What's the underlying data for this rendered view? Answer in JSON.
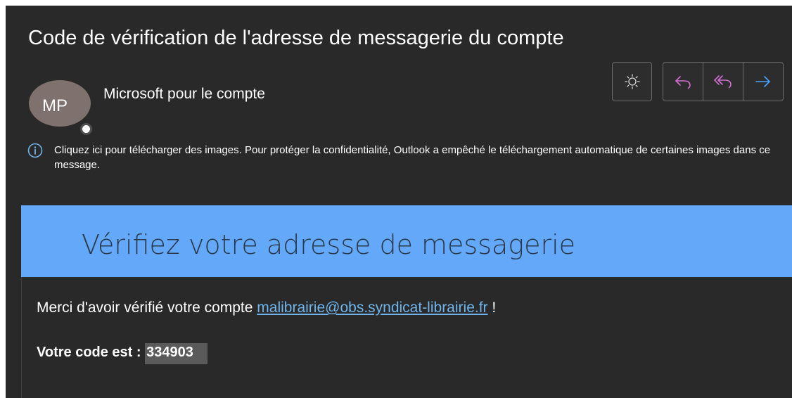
{
  "message": {
    "subject": "Code de vérification de l'adresse de messagerie du compte",
    "sender": {
      "initials": "MP",
      "name": "Microsoft pour le compte"
    },
    "info_bar": "Cliquez ici pour télécharger des images. Pour protéger la confidentialité, Outlook a empêché le téléchargement automatique de certaines images dans ce message.",
    "banner_title": "Vérifiez votre adresse de messagerie",
    "body": {
      "thanks_prefix": "Merci d'avoir vérifié votre compte ",
      "email_link": "malibrairie@obs.syndicat-librairie.fr",
      "thanks_suffix": " !",
      "code_label": "Votre code est : ",
      "code_value": "334903"
    }
  },
  "toolbar": {
    "theme_icon": "sun-icon",
    "reply_icon": "reply-arrow-icon",
    "reply_all_icon": "reply-all-arrow-icon",
    "forward_icon": "forward-arrow-icon"
  },
  "colors": {
    "background": "#292929",
    "banner": "#63a8f9",
    "link": "#6fb4ec",
    "reply_accent": "#d36fd0",
    "forward_accent": "#4aa3ff"
  }
}
